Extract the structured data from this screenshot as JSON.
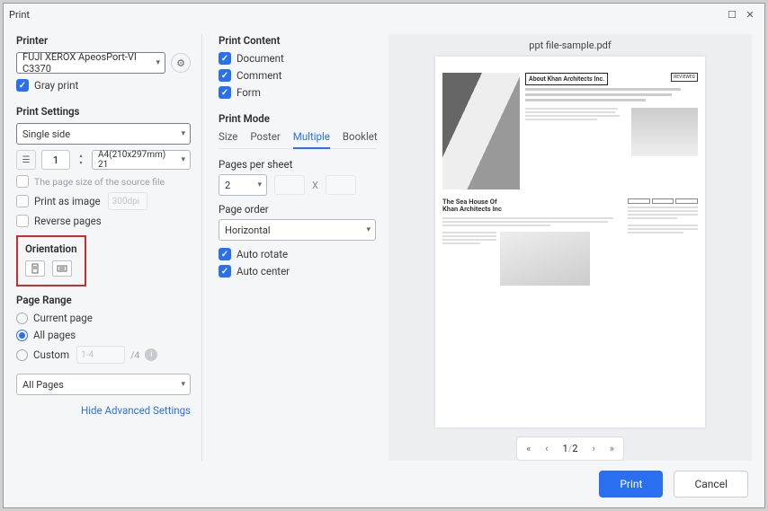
{
  "window": {
    "title": "Print"
  },
  "printer": {
    "heading": "Printer",
    "selected": "FUJI XEROX ApeosPort-VI C3370",
    "gray_print": "Gray print"
  },
  "print_settings": {
    "heading": "Print Settings",
    "duplex": "Single side",
    "copies": "1",
    "paper": "A4(210x297mm) 21",
    "source_file": "The page size of the source file",
    "print_as_image": "Print as image",
    "print_as_image_dpi": "300dpi",
    "reverse_pages": "Reverse pages"
  },
  "orientation": {
    "heading": "Orientation"
  },
  "page_range": {
    "heading": "Page Range",
    "current": "Current page",
    "all": "All pages",
    "custom": "Custom",
    "custom_placeholder": "1-4",
    "custom_total": "/4",
    "subset": "All Pages"
  },
  "link_advanced": "Hide Advanced Settings",
  "print_content": {
    "heading": "Print Content",
    "document": "Document",
    "comment": "Comment",
    "form": "Form"
  },
  "print_mode": {
    "heading": "Print Mode",
    "tabs": [
      "Size",
      "Poster",
      "Multiple",
      "Booklet"
    ],
    "active": "Multiple",
    "pages_per_sheet": "Pages per sheet",
    "pps_value": "2",
    "x": "X",
    "page_order": "Page order",
    "page_order_value": "Horizontal",
    "auto_rotate": "Auto rotate",
    "auto_center": "Auto center"
  },
  "preview": {
    "filename": "ppt file-sample.pdf",
    "slide1": {
      "title": "About Khan Architects Inc.",
      "badge": "REVIEWED"
    },
    "slide2": {
      "title1": "The Sea House Of",
      "title2": "Khan Architects Inc"
    },
    "page_cur": "1",
    "page_sep": "/",
    "page_total": "2"
  },
  "footer": {
    "print": "Print",
    "cancel": "Cancel"
  }
}
